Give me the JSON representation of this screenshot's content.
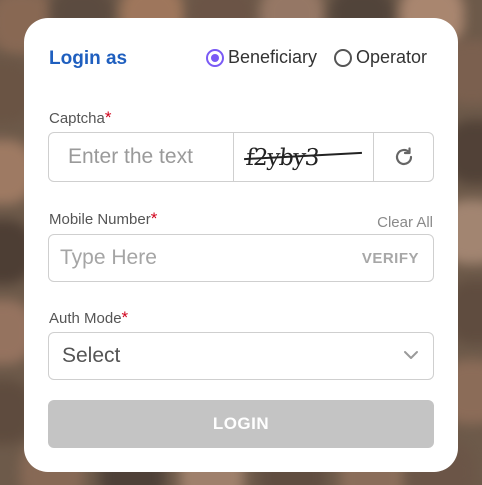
{
  "login_as": {
    "title": "Login as"
  },
  "user_type": {
    "options": [
      {
        "label": "Beneficiary",
        "selected": true
      },
      {
        "label": "Operator",
        "selected": false
      }
    ]
  },
  "captcha": {
    "label": "Captcha",
    "required_mark": "*",
    "placeholder": "Enter the text",
    "image_text": "f2yby3",
    "refresh_icon": "refresh-icon"
  },
  "mobile": {
    "label": "Mobile Number",
    "required_mark": "*",
    "placeholder": "Type Here",
    "verify_label": "VERIFY",
    "clear_all_label": "Clear All"
  },
  "auth_mode": {
    "label": "Auth Mode",
    "required_mark": "*",
    "selected": "Select",
    "chevron_icon": "chevron-down-icon"
  },
  "login_button": {
    "label": "LOGIN"
  },
  "colors": {
    "accent": "#7a5af5",
    "title": "#1f5fbf",
    "required": "#d0021b",
    "button_disabled": "#c4c4c4"
  }
}
